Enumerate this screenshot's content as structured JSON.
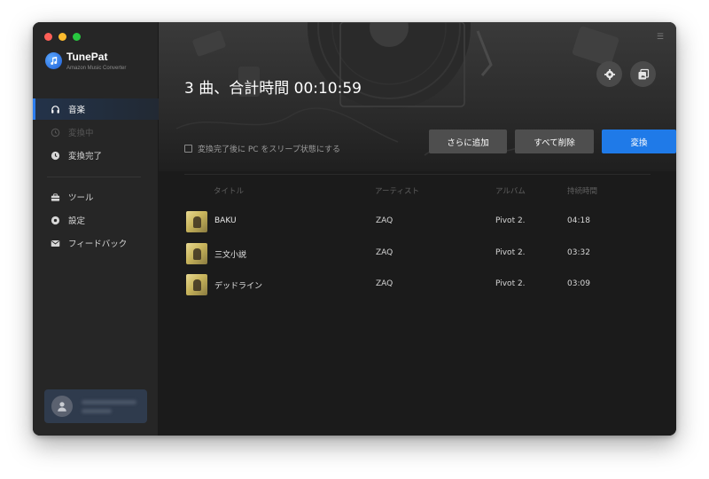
{
  "app": {
    "name": "TunePat",
    "subtitle": "Amazon Music Converter"
  },
  "sidebar": {
    "items": [
      {
        "label": "音楽",
        "icon": "headphones-icon",
        "state": "active"
      },
      {
        "label": "変換中",
        "icon": "clock-icon",
        "state": "disabled"
      },
      {
        "label": "変換完了",
        "icon": "clock-icon",
        "state": "normal"
      },
      {
        "label": "ツール",
        "icon": "toolbox-icon",
        "state": "normal"
      },
      {
        "label": "設定",
        "icon": "gear-icon",
        "state": "normal"
      },
      {
        "label": "フィードバック",
        "icon": "mail-icon",
        "state": "normal"
      }
    ]
  },
  "header": {
    "summary": "3 曲、合計時間 00:10:59"
  },
  "options": {
    "sleep_label": "変換完了後に PC をスリープ状態にする",
    "sleep_checked": false
  },
  "actions": {
    "add_more": "さらに追加",
    "delete_all": "すべて削除",
    "convert": "変換"
  },
  "table": {
    "columns": [
      "タイトル",
      "アーティスト",
      "アルバム",
      "持続時間"
    ],
    "rows": [
      {
        "title": "BAKU",
        "artist": "ZAQ",
        "album": "Pivot 2.",
        "duration": "04:18"
      },
      {
        "title": "三文小説",
        "artist": "ZAQ",
        "album": "Pivot 2.",
        "duration": "03:32"
      },
      {
        "title": "デッドライン",
        "artist": "ZAQ",
        "album": "Pivot 2.",
        "duration": "03:09"
      }
    ]
  },
  "colors": {
    "accent": "#1f7ae8",
    "sidebar_bg": "#262626",
    "main_bg": "#1b1b1b"
  }
}
